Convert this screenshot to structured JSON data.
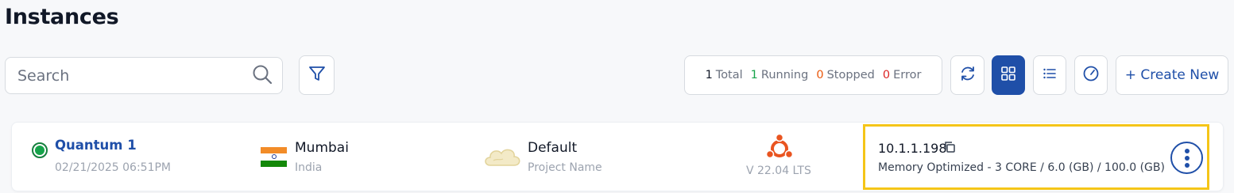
{
  "page": {
    "title": "Instances"
  },
  "search": {
    "placeholder": "Search"
  },
  "stats": {
    "total_count": "1",
    "total_label": "Total",
    "running_count": "1",
    "running_label": "Running",
    "stopped_count": "0",
    "stopped_label": "Stopped",
    "error_count": "0",
    "error_label": "Error"
  },
  "toolbar": {
    "create_label": "+ Create New"
  },
  "colors": {
    "primary": "#1f4fa8",
    "running": "#16a34a",
    "stopped": "#ea580c",
    "error": "#dc2626",
    "highlight": "#f5c518"
  },
  "instance": {
    "name": "Quantum 1",
    "created": "02/21/2025 06:51PM",
    "status": "running",
    "region": {
      "city": "Mumbai",
      "country": "India",
      "flag": "india-flag"
    },
    "project": {
      "name": "Default",
      "label": "Project Name"
    },
    "os": {
      "icon": "ubuntu-icon",
      "version": "V 22.04 LTS"
    },
    "ip": "10.1.1.198",
    "spec": "Memory Optimized - 3 CORE / 6.0 (GB) / 100.0 (GB)"
  }
}
